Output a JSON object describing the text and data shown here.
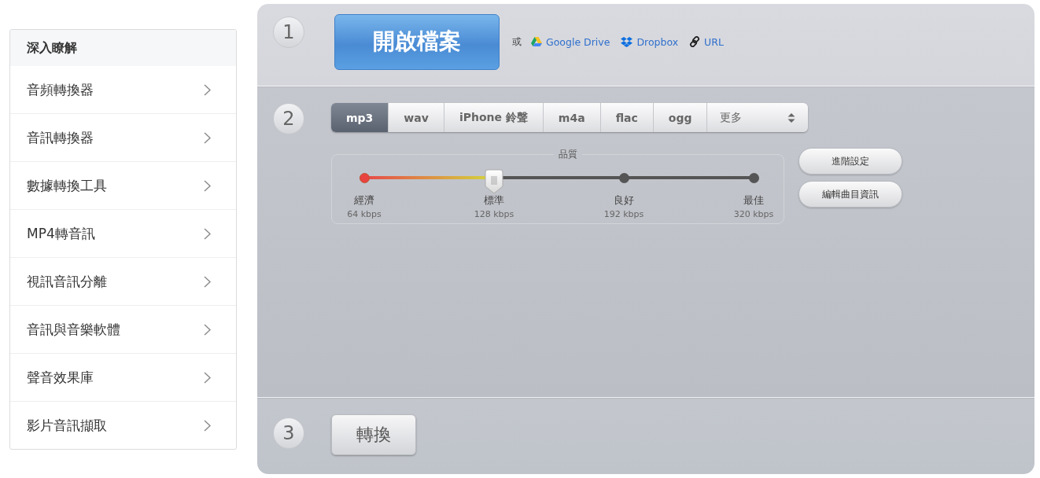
{
  "sidebar": {
    "title": "深入瞭解",
    "items": [
      {
        "label": "音頻轉換器"
      },
      {
        "label": "音訊轉換器"
      },
      {
        "label": "數據轉換工具"
      },
      {
        "label": "MP4轉音訊"
      },
      {
        "label": "視訊音訊分離"
      },
      {
        "label": "音訊與音樂軟體"
      },
      {
        "label": "聲音效果庫"
      },
      {
        "label": "影片音訊擷取"
      }
    ]
  },
  "step1": {
    "number": "1",
    "open_button": "開啟檔案",
    "or": "或",
    "sources": [
      {
        "kind": "drive",
        "label": "Google Drive"
      },
      {
        "kind": "dropbox",
        "label": "Dropbox"
      },
      {
        "kind": "url",
        "label": "URL"
      }
    ]
  },
  "step2": {
    "number": "2",
    "formats": [
      {
        "label": "mp3",
        "selected": true
      },
      {
        "label": "wav",
        "selected": false
      },
      {
        "label": "iPhone 鈴聲",
        "selected": false
      },
      {
        "label": "m4a",
        "selected": false
      },
      {
        "label": "flac",
        "selected": false
      },
      {
        "label": "ogg",
        "selected": false
      }
    ],
    "more": "更多",
    "quality": {
      "title": "品質",
      "level": 0.333,
      "stops": [
        {
          "name": "經濟",
          "rate": "64 kbps"
        },
        {
          "name": "標準",
          "rate": "128 kbps"
        },
        {
          "name": "良好",
          "rate": "192 kbps"
        },
        {
          "name": "最佳",
          "rate": "320 kbps"
        }
      ]
    },
    "buttons": [
      "進階設定",
      "編輯曲目資訊"
    ]
  },
  "step3": {
    "number": "3",
    "convert_button": "轉換"
  }
}
